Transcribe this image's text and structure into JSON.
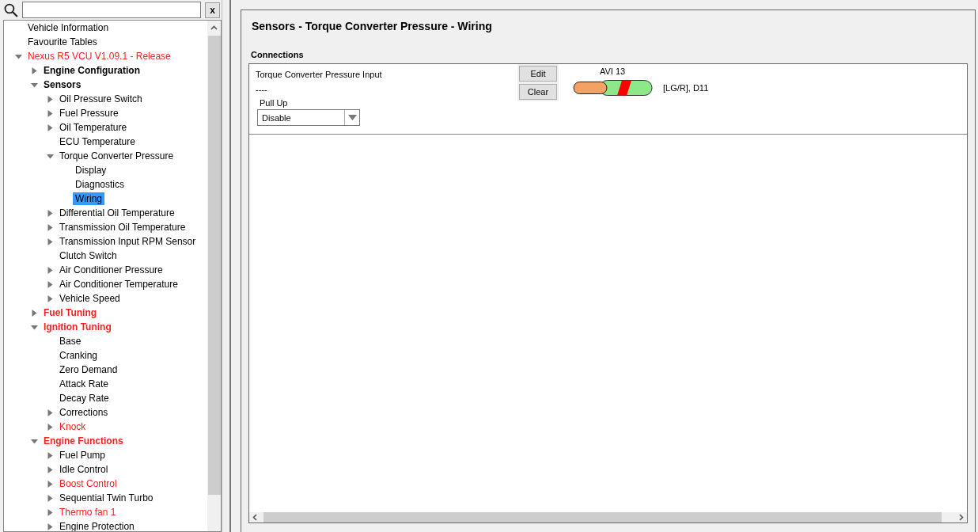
{
  "search": {
    "clear_label": "x"
  },
  "tree": [
    {
      "label": "Vehicle Information",
      "kind": "leaf",
      "modified": false,
      "selected": false
    },
    {
      "label": "Favourite Tables",
      "kind": "leaf",
      "modified": false,
      "selected": false
    },
    {
      "label": "Nexus R5 VCU V1.09.1 - Release",
      "kind": "folder",
      "expanded": true,
      "modified": true,
      "selected": false,
      "children": [
        {
          "label": "Engine Configuration",
          "kind": "folder",
          "expanded": false,
          "modified": false,
          "selected": false
        },
        {
          "label": "Sensors",
          "kind": "folder",
          "expanded": true,
          "modified": false,
          "selected": false,
          "children": [
            {
              "label": "Oil Pressure Switch",
              "kind": "folder",
              "expanded": false,
              "modified": false,
              "selected": false
            },
            {
              "label": "Fuel Pressure",
              "kind": "folder",
              "expanded": false,
              "modified": false,
              "selected": false
            },
            {
              "label": "Oil Temperature",
              "kind": "folder",
              "expanded": false,
              "modified": false,
              "selected": false
            },
            {
              "label": "ECU Temperature",
              "kind": "leaf",
              "modified": false,
              "selected": false
            },
            {
              "label": "Torque Converter Pressure",
              "kind": "folder",
              "expanded": true,
              "modified": false,
              "selected": false,
              "children": [
                {
                  "label": "Display",
                  "kind": "leaf",
                  "modified": false,
                  "selected": false
                },
                {
                  "label": "Diagnostics",
                  "kind": "leaf",
                  "modified": false,
                  "selected": false
                },
                {
                  "label": "Wiring",
                  "kind": "leaf",
                  "modified": false,
                  "selected": true
                }
              ]
            },
            {
              "label": "Differential Oil Temperature",
              "kind": "folder",
              "expanded": false,
              "modified": false,
              "selected": false
            },
            {
              "label": "Transmission Oil Temperature",
              "kind": "folder",
              "expanded": false,
              "modified": false,
              "selected": false
            },
            {
              "label": "Transmission Input RPM Sensor",
              "kind": "folder",
              "expanded": false,
              "modified": false,
              "selected": false
            },
            {
              "label": "Clutch Switch",
              "kind": "leaf",
              "modified": false,
              "selected": false
            },
            {
              "label": "Air Conditioner Pressure",
              "kind": "folder",
              "expanded": false,
              "modified": false,
              "selected": false
            },
            {
              "label": "Air Conditioner Temperature",
              "kind": "folder",
              "expanded": false,
              "modified": false,
              "selected": false
            },
            {
              "label": "Vehicle Speed",
              "kind": "folder",
              "expanded": false,
              "modified": false,
              "selected": false
            }
          ]
        },
        {
          "label": "Fuel Tuning",
          "kind": "folder",
          "expanded": false,
          "modified": true,
          "selected": false
        },
        {
          "label": "Ignition Tuning",
          "kind": "folder",
          "expanded": true,
          "modified": true,
          "selected": false,
          "children": [
            {
              "label": "Base",
              "kind": "leaf",
              "modified": false,
              "selected": false
            },
            {
              "label": "Cranking",
              "kind": "leaf",
              "modified": false,
              "selected": false
            },
            {
              "label": "Zero Demand",
              "kind": "leaf",
              "modified": false,
              "selected": false
            },
            {
              "label": "Attack Rate",
              "kind": "leaf",
              "modified": false,
              "selected": false
            },
            {
              "label": "Decay Rate",
              "kind": "leaf",
              "modified": false,
              "selected": false
            },
            {
              "label": "Corrections",
              "kind": "folder",
              "expanded": false,
              "modified": false,
              "selected": false
            },
            {
              "label": "Knock",
              "kind": "folder",
              "expanded": false,
              "modified": true,
              "selected": false
            }
          ]
        },
        {
          "label": "Engine Functions",
          "kind": "folder",
          "expanded": true,
          "modified": true,
          "selected": false,
          "children": [
            {
              "label": "Fuel Pump",
              "kind": "folder",
              "expanded": false,
              "modified": false,
              "selected": false
            },
            {
              "label": "Idle Control",
              "kind": "folder",
              "expanded": false,
              "modified": false,
              "selected": false
            },
            {
              "label": "Boost Control",
              "kind": "folder",
              "expanded": false,
              "modified": true,
              "selected": false
            },
            {
              "label": "Sequential Twin Turbo",
              "kind": "folder",
              "expanded": false,
              "modified": false,
              "selected": false
            },
            {
              "label": "Thermo fan 1",
              "kind": "folder",
              "expanded": false,
              "modified": true,
              "selected": false
            },
            {
              "label": "Engine Protection",
              "kind": "folder",
              "expanded": false,
              "modified": false,
              "selected": false
            }
          ]
        }
      ]
    }
  ],
  "page": {
    "title": "Sensors - Torque Converter Pressure - Wiring",
    "section": "Connections",
    "connection": {
      "name": "Torque Converter Pressure Input",
      "value": "----",
      "pull_up_label": "Pull Up",
      "pull_up_value": "Disable",
      "buttons": [
        "Edit",
        "Clear"
      ],
      "pin": "AVI 13",
      "wire": "[LG/R], D11"
    }
  }
}
